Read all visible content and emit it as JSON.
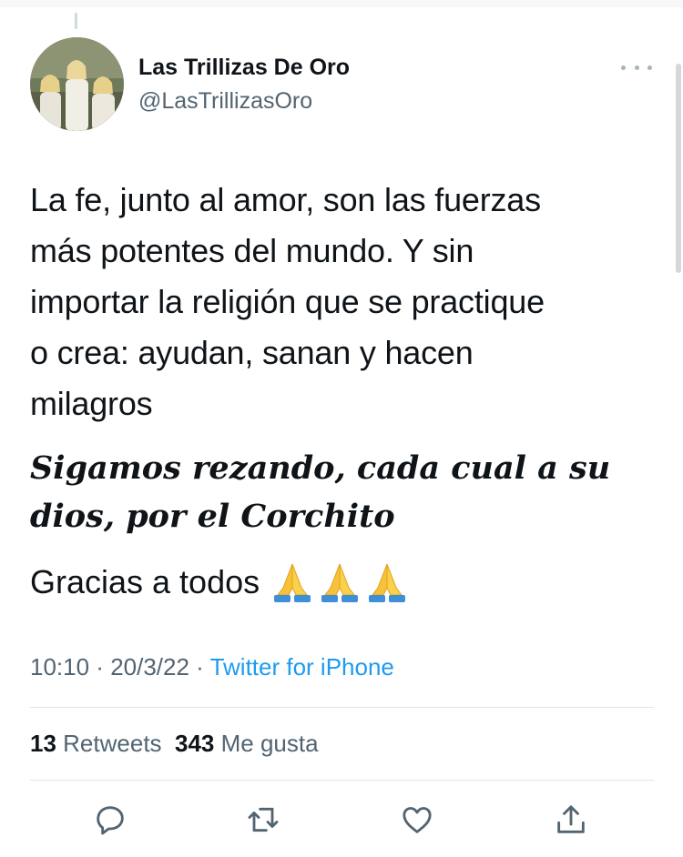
{
  "tweet": {
    "display_name": "Las Trillizas De Oro",
    "handle": "@LasTrillizasOro",
    "text": "La fe, junto al amor, son las fuerzas\nmás potentes del mundo. Y sin\nimportar la religión que se practique\no crea: ayudan, sanan y hacen\nmilagros",
    "bold_text": "Sigamos rezando, cada cual a su\ndios, por el Corchito",
    "thanks_text": "Gracias a todos",
    "emojis": [
      "praying-hands-icon",
      "praying-hands-icon",
      "praying-hands-icon"
    ],
    "time": "10:10",
    "date": "20/3/22",
    "separator": " · ",
    "source": "Twitter for iPhone"
  },
  "stats": {
    "retweets_count": "13",
    "retweets_label": "Retweets",
    "likes_count": "343",
    "likes_label": "Me gusta"
  },
  "actions": [
    "reply-icon",
    "retweet-icon",
    "like-icon",
    "share-icon"
  ],
  "colors": {
    "text": "#0f1419",
    "secondary": "#536471",
    "link": "#1d9bf0",
    "divider": "#e1e6ea",
    "icon": "#536471"
  }
}
